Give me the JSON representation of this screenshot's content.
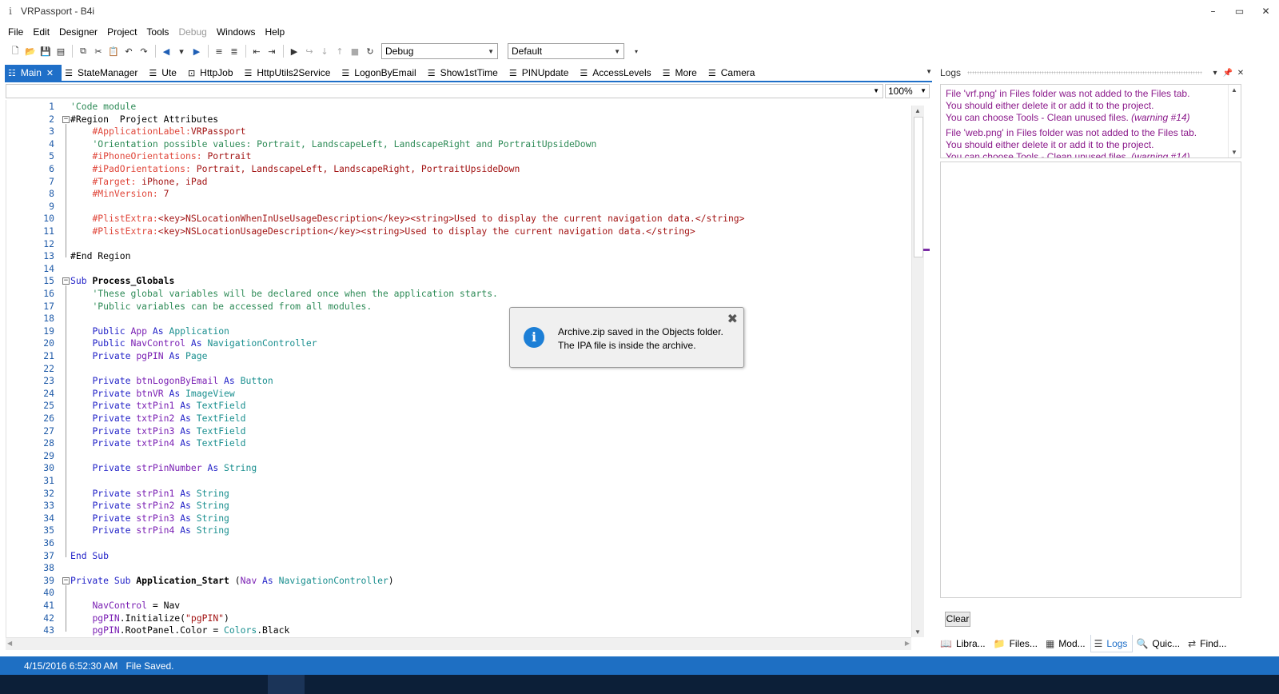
{
  "window": {
    "title": "VRPassport - B4i",
    "app_icon": "i",
    "buttons": [
      "–",
      "▭",
      "✕"
    ]
  },
  "menu": [
    "File",
    "Edit",
    "Designer",
    "Project",
    "Tools",
    "Debug",
    "Windows",
    "Help"
  ],
  "toolbar": {
    "build_config": "Debug",
    "target_config": "Default"
  },
  "tabs": [
    {
      "label": "Main",
      "active": true
    },
    {
      "label": "StateManager"
    },
    {
      "label": "Ute"
    },
    {
      "label": "HttpJob"
    },
    {
      "label": "HttpUtils2Service"
    },
    {
      "label": "LogonByEmail"
    },
    {
      "label": "Show1stTime"
    },
    {
      "label": "PINUpdate"
    },
    {
      "label": "AccessLevels"
    },
    {
      "label": "More"
    },
    {
      "label": "Camera"
    }
  ],
  "zoom": "100%",
  "code_lines": [
    {
      "n": 1,
      "html": "<span class='c-comment'>'Code module</span>"
    },
    {
      "n": 2,
      "html": "#Region  Project Attributes",
      "fold": "⊟"
    },
    {
      "n": 3,
      "html": "    <span class='c-directive'>#ApplicationLabel:</span><span class='c-str'>VRPassport</span>"
    },
    {
      "n": 4,
      "html": "    <span class='c-comment'>'Orientation possible values: Portrait, LandscapeLeft, LandscapeRight and PortraitUpsideDown</span>"
    },
    {
      "n": 5,
      "html": "    <span class='c-directive'>#iPhoneOrientations:</span><span class='c-str'> Portrait</span>"
    },
    {
      "n": 6,
      "html": "    <span class='c-directive'>#iPadOrientations:</span><span class='c-str'> Portrait, LandscapeLeft, LandscapeRight, PortraitUpsideDown</span>"
    },
    {
      "n": 7,
      "html": "    <span class='c-directive'>#Target:</span><span class='c-str'> iPhone, iPad</span>"
    },
    {
      "n": 8,
      "html": "    <span class='c-directive'>#MinVersion:</span><span class='c-str'> 7</span>"
    },
    {
      "n": 9,
      "html": ""
    },
    {
      "n": 10,
      "html": "    <span class='c-directive'>#PlistExtra:</span><span class='c-str'>&lt;key&gt;NSLocationWhenInUseUsageDescription&lt;/key&gt;&lt;string&gt;Used to display the current navigation data.&lt;/string&gt;</span>"
    },
    {
      "n": 11,
      "html": "    <span class='c-directive'>#PlistExtra:</span><span class='c-str'>&lt;key&gt;NSLocationUsageDescription&lt;/key&gt;&lt;string&gt;Used to display the current navigation data.&lt;/string&gt;</span>"
    },
    {
      "n": 12,
      "html": ""
    },
    {
      "n": 13,
      "html": "#End Region"
    },
    {
      "n": 14,
      "html": ""
    },
    {
      "n": 15,
      "html": "<span class='c-kw'>Sub</span> <span class='c-bold'>Process_Globals</span>",
      "fold": "⊟"
    },
    {
      "n": 16,
      "html": "    <span class='c-comment'>'These global variables will be declared once when the application starts.</span>"
    },
    {
      "n": 17,
      "html": "    <span class='c-comment'>'Public variables can be accessed from all modules.</span>"
    },
    {
      "n": 18,
      "html": ""
    },
    {
      "n": 19,
      "html": "    <span class='c-kw'>Public</span> <span class='c-var'>App</span> <span class='c-kw'>As</span> <span class='c-type'>Application</span>"
    },
    {
      "n": 20,
      "html": "    <span class='c-kw'>Public</span> <span class='c-var'>NavControl</span> <span class='c-kw'>As</span> <span class='c-type'>NavigationController</span>"
    },
    {
      "n": 21,
      "html": "    <span class='c-kw'>Private</span> <span class='c-var'>pgPIN</span> <span class='c-kw'>As</span> <span class='c-type'>Page</span>"
    },
    {
      "n": 22,
      "html": ""
    },
    {
      "n": 23,
      "html": "    <span class='c-kw'>Private</span> <span class='c-var'>btnLogonByEmail</span> <span class='c-kw'>As</span> <span class='c-type'>Button</span>"
    },
    {
      "n": 24,
      "html": "    <span class='c-kw'>Private</span> <span class='c-var'>btnVR</span> <span class='c-kw'>As</span> <span class='c-type'>ImageView</span>"
    },
    {
      "n": 25,
      "html": "    <span class='c-kw'>Private</span> <span class='c-var'>txtPin1</span> <span class='c-kw'>As</span> <span class='c-type'>TextField</span>"
    },
    {
      "n": 26,
      "html": "    <span class='c-kw'>Private</span> <span class='c-var'>txtPin2</span> <span class='c-kw'>As</span> <span class='c-type'>TextField</span>"
    },
    {
      "n": 27,
      "html": "    <span class='c-kw'>Private</span> <span class='c-var'>txtPin3</span> <span class='c-kw'>As</span> <span class='c-type'>TextField</span>"
    },
    {
      "n": 28,
      "html": "    <span class='c-kw'>Private</span> <span class='c-var'>txtPin4</span> <span class='c-kw'>As</span> <span class='c-type'>TextField</span>"
    },
    {
      "n": 29,
      "html": ""
    },
    {
      "n": 30,
      "html": "    <span class='c-kw'>Private</span> <span class='c-var'>strPinNumber</span> <span class='c-kw'>As</span> <span class='c-type'>String</span>"
    },
    {
      "n": 31,
      "html": ""
    },
    {
      "n": 32,
      "html": "    <span class='c-kw'>Private</span> <span class='c-var'>strPin1</span> <span class='c-kw'>As</span> <span class='c-type'>String</span>"
    },
    {
      "n": 33,
      "html": "    <span class='c-kw'>Private</span> <span class='c-var'>strPin2</span> <span class='c-kw'>As</span> <span class='c-type'>String</span>"
    },
    {
      "n": 34,
      "html": "    <span class='c-kw'>Private</span> <span class='c-var'>strPin3</span> <span class='c-kw'>As</span> <span class='c-type'>String</span>"
    },
    {
      "n": 35,
      "html": "    <span class='c-kw'>Private</span> <span class='c-var'>strPin4</span> <span class='c-kw'>As</span> <span class='c-type'>String</span>"
    },
    {
      "n": 36,
      "html": ""
    },
    {
      "n": 37,
      "html": "<span class='c-kw'>End Sub</span>"
    },
    {
      "n": 38,
      "html": ""
    },
    {
      "n": 39,
      "html": "<span class='c-kw'>Private Sub</span> <span class='c-bold'>Application_Start</span> (<span class='c-var'>Nav</span> <span class='c-kw'>As</span> <span class='c-type'>NavigationController</span>)",
      "fold": "⊟"
    },
    {
      "n": 40,
      "html": ""
    },
    {
      "n": 41,
      "html": "    <span class='c-var'>NavControl</span> = Nav"
    },
    {
      "n": 42,
      "html": "    <span class='c-var'>pgPIN</span>.Initialize(<span class='c-str'>\"pgPIN\"</span>)"
    },
    {
      "n": 43,
      "html": "    <span class='c-var'>pgPIN</span>.RootPanel.Color = <span class='c-type'>Colors</span>.Black"
    }
  ],
  "toast": {
    "line1": "Archive.zip saved in the Objects folder.",
    "line2": "The IPA file is inside the archive."
  },
  "logs": {
    "title": "Logs",
    "messages": [
      {
        "l1": "File 'vrf.png' in Files folder was not added to the Files tab.",
        "l2": "You should either delete it or add it to the project.",
        "l3": "You can choose Tools - Clean unused files.",
        "warn": "(warning #14)"
      },
      {
        "l1": "File 'web.png' in Files folder was not added to the Files tab.",
        "l2": "You should either delete it or add it to the project.",
        "l3": "You can choose Tools - Clean unused files.",
        "warn": "(warning #14)"
      }
    ],
    "clear_label": "Clear"
  },
  "bottom_tabs": [
    {
      "label": "Libra...",
      "icon": "📖"
    },
    {
      "label": "Files...",
      "icon": "📁"
    },
    {
      "label": "Mod...",
      "icon": "▦"
    },
    {
      "label": "Logs",
      "icon": "☰",
      "active": true
    },
    {
      "label": "Quic...",
      "icon": "🔍"
    },
    {
      "label": "Find...",
      "icon": "⇄"
    }
  ],
  "status": {
    "timestamp": "4/15/2016 6:52:30 AM",
    "message": "File Saved."
  },
  "colors": {
    "accent": "#1f6fc8",
    "statusbar": "#1e6fc3",
    "log_text": "#8b1a8b"
  }
}
